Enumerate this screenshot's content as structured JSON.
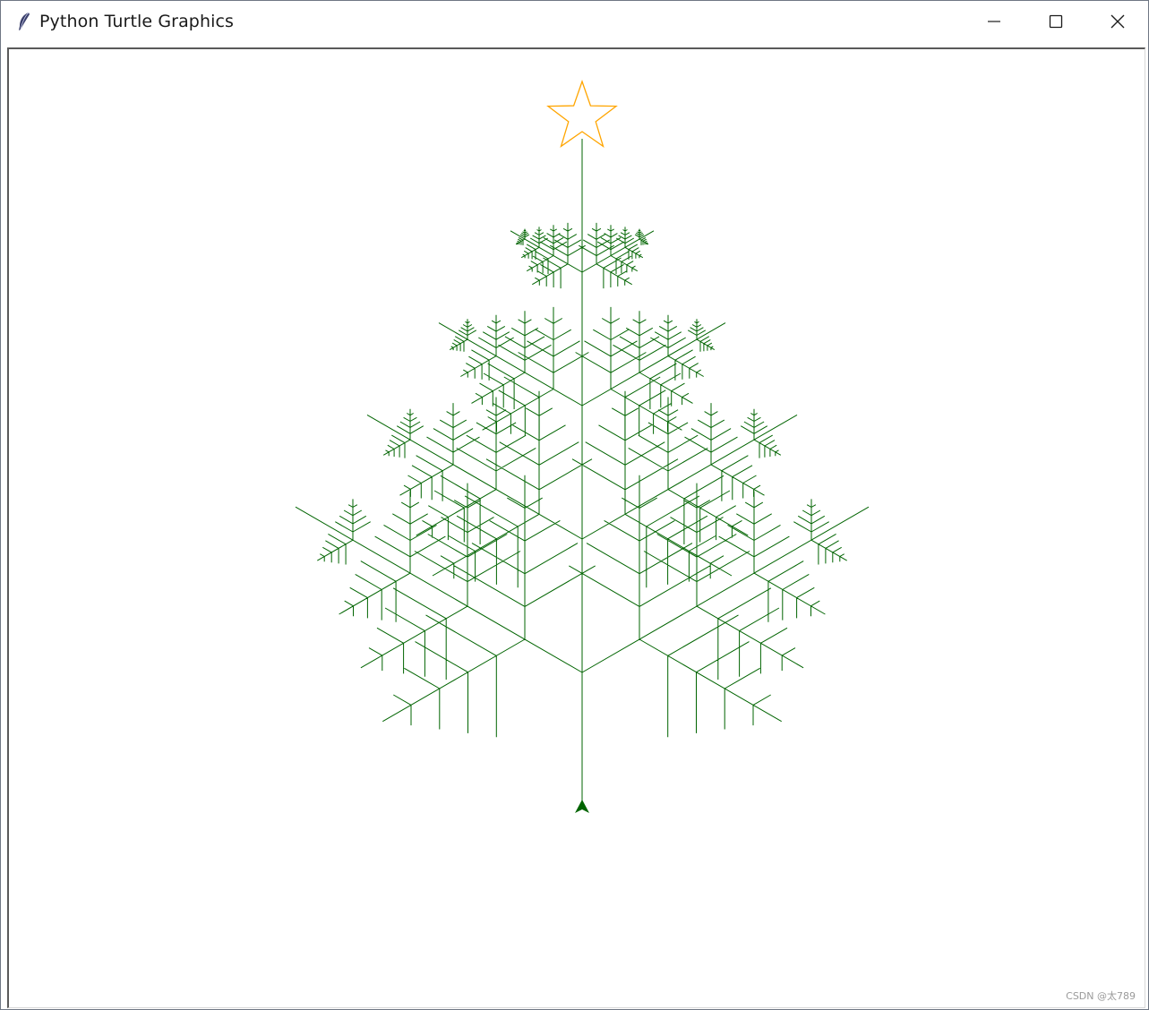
{
  "window": {
    "title": "Python Turtle Graphics",
    "controls": {
      "minimize": "minimize-icon",
      "maximize": "maximize-icon",
      "close": "close-icon"
    }
  },
  "canvas": {
    "background": "#ffffff",
    "tree_color": "#006400",
    "star_color": "#ffa500",
    "turtle_color": "#006400"
  },
  "watermark": "CSDN @太789"
}
